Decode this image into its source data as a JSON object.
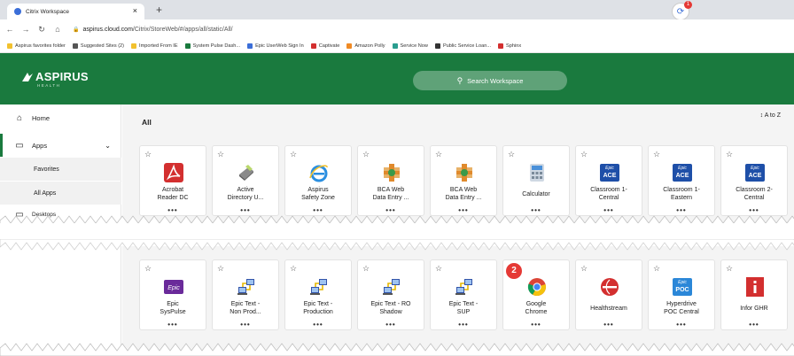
{
  "browser": {
    "tab_title": "Citrix Workspace",
    "tab_close": "×",
    "new_tab": "+",
    "extension_badge": "1",
    "url_host": "aspirus.cloud.com",
    "url_path": "/Citrix/StoreWeb/#/apps/all/static/All/",
    "bookmarks": [
      {
        "label": "Aspirus favorites folder",
        "color": "#f2c12e"
      },
      {
        "label": "Suggested Sites (2)",
        "color": "#555555"
      },
      {
        "label": "Imported From IE",
        "color": "#f2c12e"
      },
      {
        "label": "System Pulse Dash...",
        "color": "#1a7a3e"
      },
      {
        "label": "Epic UserWeb Sign In",
        "color": "#3b6ed8"
      },
      {
        "label": "Captivate",
        "color": "#d32f2f"
      },
      {
        "label": "Amazon Polly",
        "color": "#f08a24"
      },
      {
        "label": "Service Now",
        "color": "#2a9d8f"
      },
      {
        "label": "Public Service Loan...",
        "color": "#333333"
      },
      {
        "label": "Sphinx",
        "color": "#d32f2f"
      }
    ]
  },
  "header": {
    "logo": "ASPIRUS",
    "logo_sub": "HEALTH",
    "search_placeholder": "Search Workspace",
    "color": "#1a7a3e"
  },
  "sidebar": {
    "home": "Home",
    "apps": "Apps",
    "favorites": "Favorites",
    "all_apps": "All Apps",
    "desktops": "Desktops"
  },
  "main": {
    "heading": "All",
    "sort": "A to Z",
    "more": "•••",
    "row1": [
      {
        "name": "Acrobat\nReader DC",
        "icon": "acrobat-icon"
      },
      {
        "name": "Active\nDirectory U...",
        "icon": "active-directory-icon"
      },
      {
        "name": "Aspirus\nSafety Zone",
        "icon": "internet-explorer-icon"
      },
      {
        "name": "BCA Web\nData Entry ...",
        "icon": "bca-web-icon"
      },
      {
        "name": "BCA Web\nData Entry ...",
        "icon": "bca-web-icon"
      },
      {
        "name": "Calculator",
        "icon": "calculator-icon"
      },
      {
        "name": "Classroom 1-\nCentral",
        "icon": "epic-ace-icon"
      },
      {
        "name": "Classroom 1-\nEastern",
        "icon": "epic-ace-icon"
      },
      {
        "name": "Classroom 2-\nCentral",
        "icon": "epic-ace-icon"
      }
    ],
    "row2": [
      {
        "name": "Epic\nSysPulse",
        "icon": "epic-syspulse-icon"
      },
      {
        "name": "Epic Text -\nNon Prod...",
        "icon": "epic-text-icon"
      },
      {
        "name": "Epic Text -\nProduction",
        "icon": "epic-text-icon"
      },
      {
        "name": "Epic Text - RO\nShadow",
        "icon": "epic-text-icon"
      },
      {
        "name": "Epic Text -\nSUP",
        "icon": "epic-text-icon"
      },
      {
        "name": "Google\nChrome",
        "icon": "chrome-icon"
      },
      {
        "name": "Healthstream",
        "icon": "healthstream-icon"
      },
      {
        "name": "Hyperdrive\nPOC Central",
        "icon": "epic-poc-icon"
      },
      {
        "name": "Infor GHR",
        "icon": "infor-icon"
      }
    ],
    "step_badge": "2",
    "ace_label": "ACE",
    "poc_label": "POC",
    "epic_label": "Epic"
  }
}
